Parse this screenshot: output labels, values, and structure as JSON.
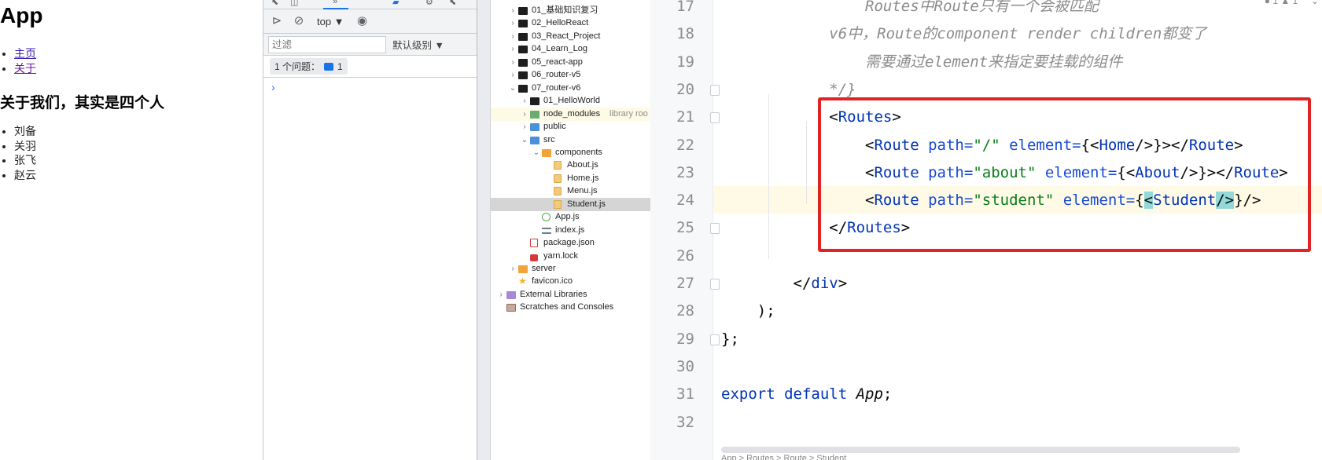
{
  "page": {
    "title": "App",
    "nav": [
      "主页",
      "关于"
    ],
    "heading": "关于我们，其实是四个人",
    "people": [
      "刘备",
      "关羽",
      "张飞",
      "赵云"
    ]
  },
  "devtools": {
    "context": "top ▼",
    "filter_placeholder": "过滤",
    "levels": "默认级别 ▼",
    "issues": "1 个问题：",
    "issues_count": "1",
    "prompt": "›"
  },
  "tree": [
    {
      "indent": 0,
      "chev": "›",
      "icon": "ic-folder-dark",
      "label": "01_基础知识复习"
    },
    {
      "indent": 0,
      "chev": "›",
      "icon": "ic-folder-dark",
      "label": "02_HelloReact"
    },
    {
      "indent": 0,
      "chev": "›",
      "icon": "ic-folder-dark",
      "label": "03_React_Project"
    },
    {
      "indent": 0,
      "chev": "›",
      "icon": "ic-folder-dark",
      "label": "04_Learn_Log"
    },
    {
      "indent": 0,
      "chev": "›",
      "icon": "ic-folder-dark",
      "label": "05_react-app"
    },
    {
      "indent": 0,
      "chev": "›",
      "icon": "ic-folder-dark",
      "label": "06_router-v5"
    },
    {
      "indent": 0,
      "chev": "⌄",
      "icon": "ic-folder-dark",
      "label": "07_router-v6"
    },
    {
      "indent": 1,
      "chev": "›",
      "icon": "ic-folder-dark",
      "label": "01_HelloWorld"
    },
    {
      "indent": 1,
      "chev": "›",
      "icon": "ic-folder-green",
      "label": "node_modules",
      "extra": "library roo",
      "highlight": true
    },
    {
      "indent": 1,
      "chev": "›",
      "icon": "ic-folder-blue",
      "label": "public"
    },
    {
      "indent": 1,
      "chev": "⌄",
      "icon": "ic-folder-blue",
      "label": "src"
    },
    {
      "indent": 2,
      "chev": "⌄",
      "icon": "ic-folder-orange",
      "label": "components"
    },
    {
      "indent": 3,
      "chev": "",
      "icon": "ic-file-js",
      "label": "About.js"
    },
    {
      "indent": 3,
      "chev": "",
      "icon": "ic-file-js",
      "label": "Home.js"
    },
    {
      "indent": 3,
      "chev": "",
      "icon": "ic-file-js",
      "label": "Menu.js"
    },
    {
      "indent": 3,
      "chev": "",
      "icon": "ic-file-js",
      "label": "Student.js",
      "selected": true
    },
    {
      "indent": 2,
      "chev": "",
      "icon": "ic-file-react",
      "label": "App.js"
    },
    {
      "indent": 2,
      "chev": "",
      "icon": "ic-file-index",
      "label": "index.js"
    },
    {
      "indent": 1,
      "chev": "",
      "icon": "ic-file-json",
      "label": "package.json"
    },
    {
      "indent": 1,
      "chev": "",
      "icon": "ic-file-lock",
      "label": "yarn.lock"
    },
    {
      "indent": 0,
      "chev": "›",
      "icon": "ic-folder-orange",
      "label": "server"
    },
    {
      "indent": 0,
      "chev": "",
      "icon": "ic-star",
      "label": "favicon.ico"
    },
    {
      "indent": -1,
      "chev": "›",
      "icon": "ic-libs",
      "label": "External Libraries"
    },
    {
      "indent": -1,
      "chev": "",
      "icon": "ic-scratch",
      "label": "Scratches and Consoles"
    }
  ],
  "editor": {
    "line_numbers": [
      "17",
      "18",
      "19",
      "20",
      "21",
      "22",
      "23",
      "24",
      "25",
      "26",
      "27",
      "28",
      "29",
      "30",
      "31",
      "32"
    ],
    "lines": [
      [
        {
          "t": "                Routes中Route只有一个会被匹配",
          "c": "c-comment"
        }
      ],
      [
        {
          "t": "            v6中，Route的component render children都变了",
          "c": "c-comment"
        }
      ],
      [
        {
          "t": "                需要通过element来指定要挂载的组件",
          "c": "c-comment"
        }
      ],
      [
        {
          "t": "            */}",
          "c": "c-comment"
        }
      ],
      [
        {
          "t": "            <",
          "c": ""
        },
        {
          "t": "Routes",
          "c": "c-tag"
        },
        {
          "t": ">",
          "c": ""
        }
      ],
      [
        {
          "t": "                <",
          "c": ""
        },
        {
          "t": "Route",
          "c": "c-tag"
        },
        {
          "t": " path=",
          "c": "c-attr"
        },
        {
          "t": "\"/\"",
          "c": "c-str"
        },
        {
          "t": " element=",
          "c": "c-attr"
        },
        {
          "t": "{<",
          "c": ""
        },
        {
          "t": "Home",
          "c": "c-tag"
        },
        {
          "t": "/>}></",
          "c": ""
        },
        {
          "t": "Route",
          "c": "c-tag"
        },
        {
          "t": ">",
          "c": ""
        }
      ],
      [
        {
          "t": "                <",
          "c": ""
        },
        {
          "t": "Route",
          "c": "c-tag"
        },
        {
          "t": " path=",
          "c": "c-attr"
        },
        {
          "t": "\"about\"",
          "c": "c-str"
        },
        {
          "t": " element=",
          "c": "c-attr"
        },
        {
          "t": "{<",
          "c": ""
        },
        {
          "t": "About",
          "c": "c-tag"
        },
        {
          "t": "/>}></",
          "c": ""
        },
        {
          "t": "Route",
          "c": "c-tag"
        },
        {
          "t": ">",
          "c": ""
        }
      ],
      [
        {
          "t": "                <",
          "c": ""
        },
        {
          "t": "Route",
          "c": "c-tag"
        },
        {
          "t": " path=",
          "c": "c-attr"
        },
        {
          "t": "\"student\"",
          "c": "c-str"
        },
        {
          "t": " element=",
          "c": "c-attr"
        },
        {
          "t": "{",
          "c": ""
        },
        {
          "t": "<",
          "c": "c-hl"
        },
        {
          "t": "Student",
          "c": "c-tag"
        },
        {
          "t": "/>",
          "c": "c-hl"
        },
        {
          "t": "}/>",
          "c": ""
        }
      ],
      [
        {
          "t": "            </",
          "c": ""
        },
        {
          "t": "Routes",
          "c": "c-tag"
        },
        {
          "t": ">",
          "c": ""
        }
      ],
      [
        {
          "t": "",
          "c": ""
        }
      ],
      [
        {
          "t": "        </",
          "c": ""
        },
        {
          "t": "div",
          "c": "c-tag"
        },
        {
          "t": ">",
          "c": ""
        }
      ],
      [
        {
          "t": "    );",
          "c": ""
        }
      ],
      [
        {
          "t": "};",
          "c": ""
        }
      ],
      [
        {
          "t": "",
          "c": ""
        }
      ],
      [
        {
          "t": "export default ",
          "c": "c-kw"
        },
        {
          "t": "App",
          "c": "c-fn"
        },
        {
          "t": ";",
          "c": ""
        }
      ],
      [
        {
          "t": "",
          "c": ""
        }
      ]
    ],
    "status": "App > Routes > Route > Student"
  }
}
